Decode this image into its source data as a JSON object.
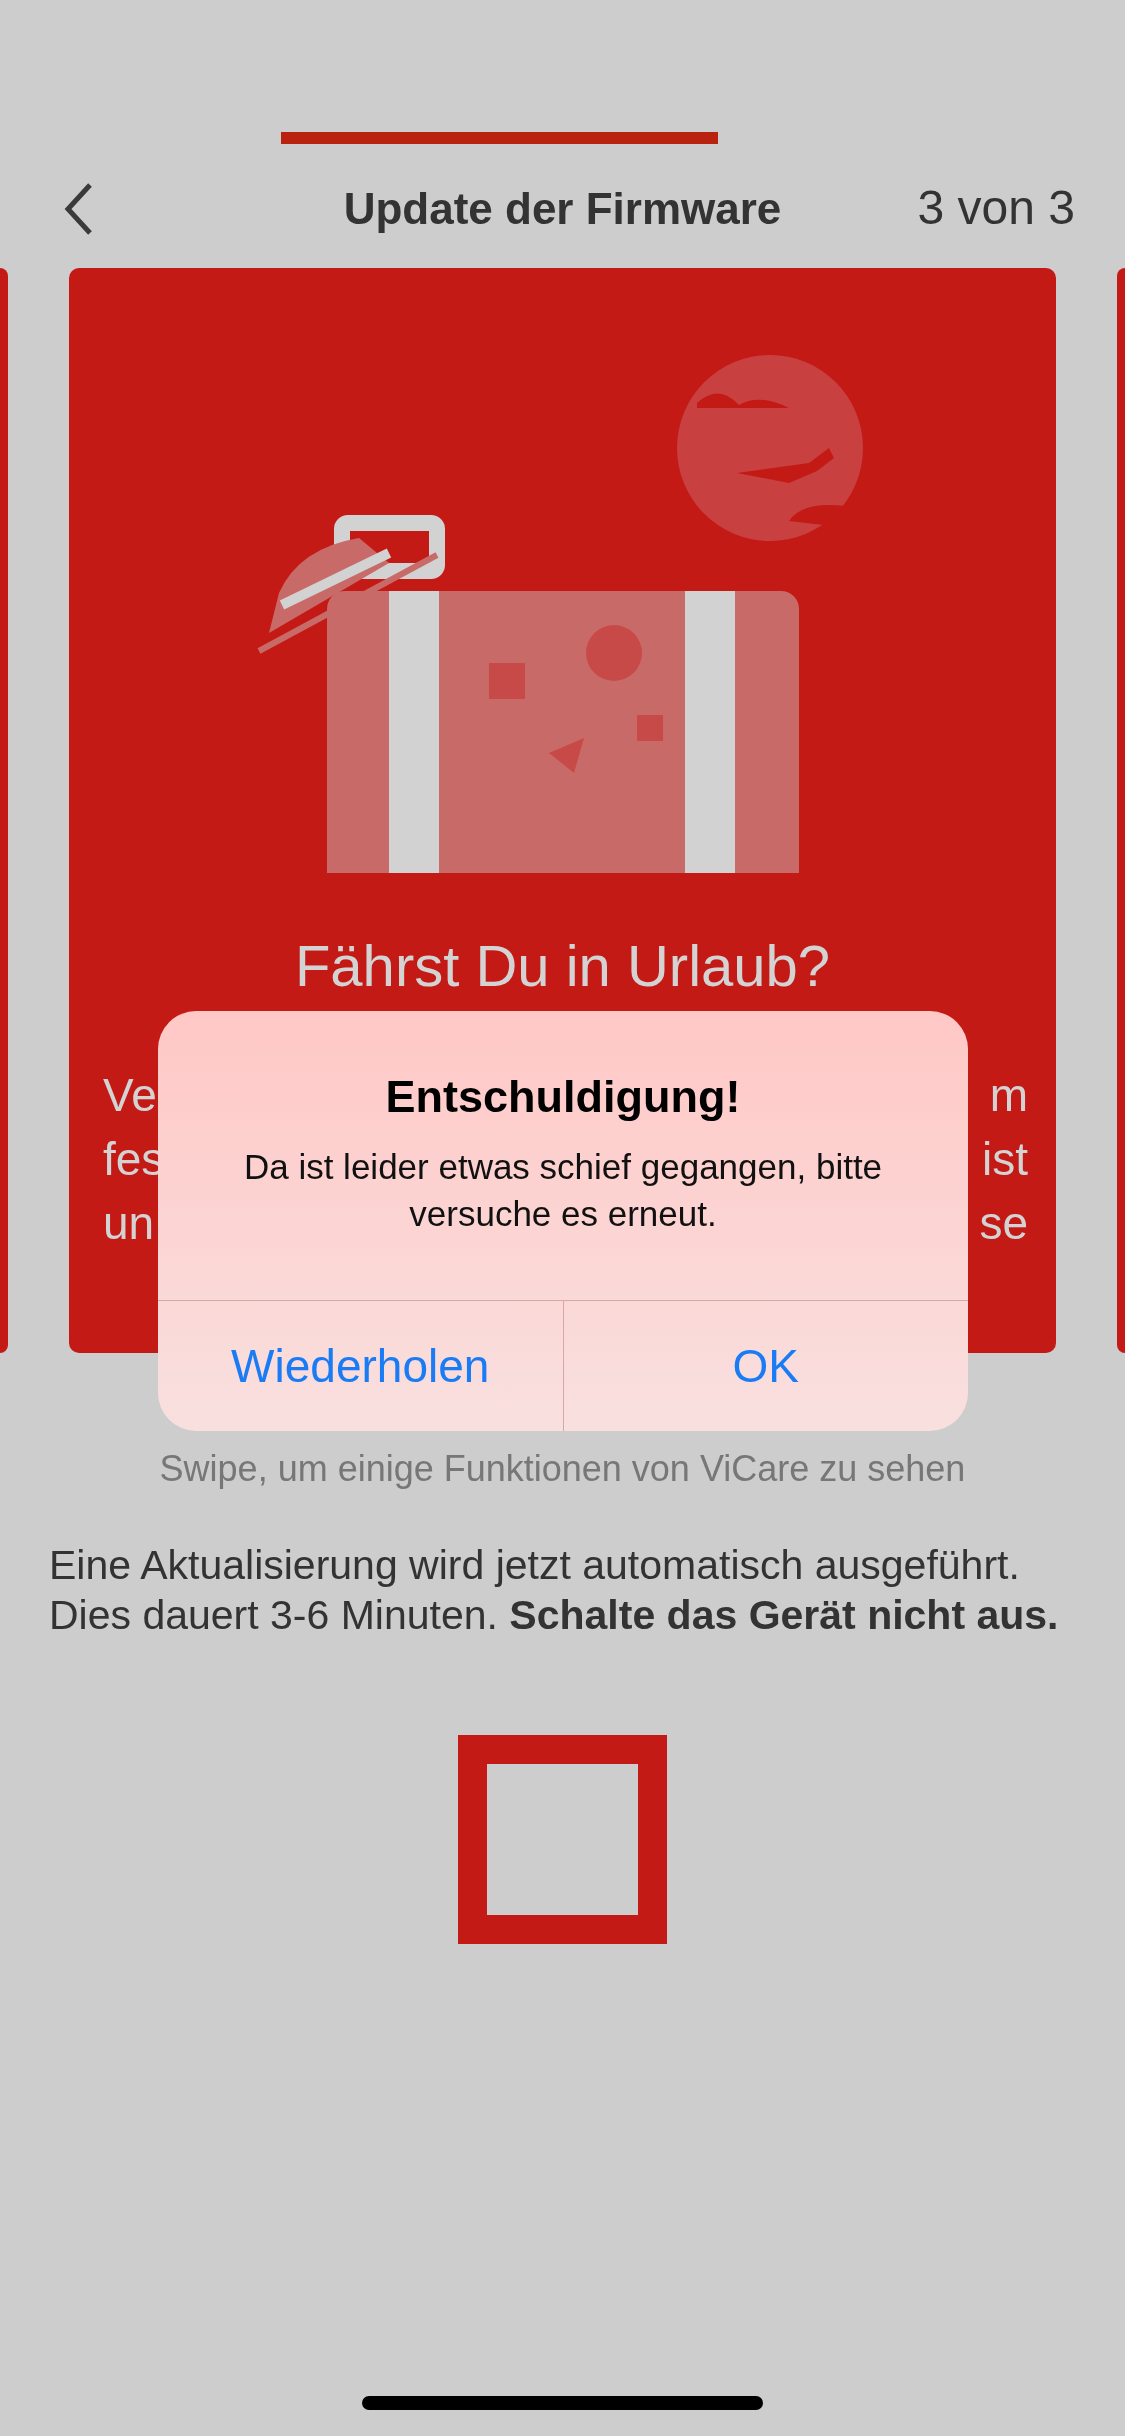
{
  "nav": {
    "title": "Update der Firmware",
    "step": "3 von 3"
  },
  "card": {
    "title": "Fährst Du in Urlaub?",
    "lines": [
      {
        "left": "Ve",
        "right": "m"
      },
      {
        "left": "fes",
        "right": "ist"
      },
      {
        "left": "un",
        "right": "se"
      }
    ]
  },
  "alert": {
    "title": "Entschuldigung!",
    "message": "Da ist leider etwas schief gegangen, bitte versuche es erneut.",
    "buttons": [
      "Wiederholen",
      "OK"
    ]
  },
  "hint": "Swipe, um einige Funktionen von ViCare zu sehen",
  "info": "Eine Aktualisierung wird jetzt automatisch ausgeführt. Dies dauert 3-6 Minuten. **Schalte das Gerät nicht aus.**"
}
